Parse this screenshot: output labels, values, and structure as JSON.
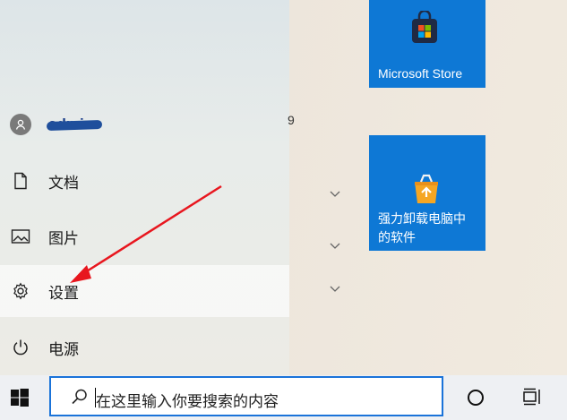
{
  "user": {
    "name": "admin"
  },
  "left_rail": {
    "items": [
      {
        "label": "文档",
        "icon": "document-icon"
      },
      {
        "label": "图片",
        "icon": "pictures-icon"
      },
      {
        "label": "设置",
        "icon": "gear-icon",
        "selected": true
      },
      {
        "label": "电源",
        "icon": "power-icon"
      }
    ]
  },
  "middle": {
    "partial_text": "9"
  },
  "tiles": [
    {
      "label": "Microsoft Store",
      "icon": "store-bag-icon"
    },
    {
      "label_line1": "强力卸载电脑中",
      "label_line2": "的软件",
      "icon": "recycle-box-icon"
    }
  ],
  "taskbar": {
    "search_placeholder": "在这里输入你要搜索的内容"
  },
  "colors": {
    "tile_blue": "#0e78d5",
    "search_border": "#1a73d9",
    "annotation_arrow": "#e8161e"
  }
}
